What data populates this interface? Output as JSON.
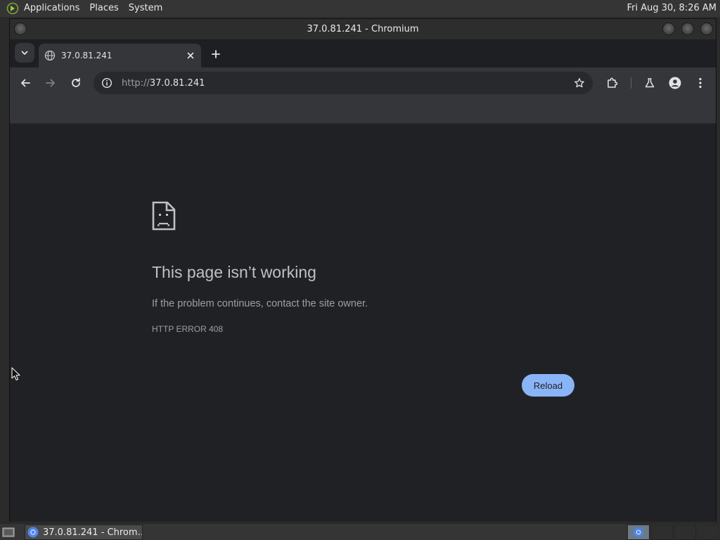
{
  "top_panel": {
    "menus": [
      "Applications",
      "Places",
      "System"
    ],
    "clock": "Fri Aug 30,  8:26 AM"
  },
  "window": {
    "title": "37.0.81.241 - Chromium"
  },
  "tabs": [
    {
      "title": "37.0.81.241",
      "favicon": "globe-icon",
      "active": true
    }
  ],
  "toolbar": {
    "url_scheme": "http://",
    "url_host": "37.0.81.241"
  },
  "page": {
    "icon": "sad-page-icon",
    "heading": "This page isn’t working",
    "description": "If the problem continues, contact the site owner.",
    "error_code": "HTTP ERROR 408",
    "reload_label": "Reload"
  },
  "taskbar": {
    "tasks": [
      {
        "label": "37.0.81.241 - Chrom…",
        "icon": "chromium-icon"
      }
    ]
  },
  "colors": {
    "accent": "#8ab4f8",
    "page_background": "#202124",
    "toolbar": "#35363a"
  }
}
